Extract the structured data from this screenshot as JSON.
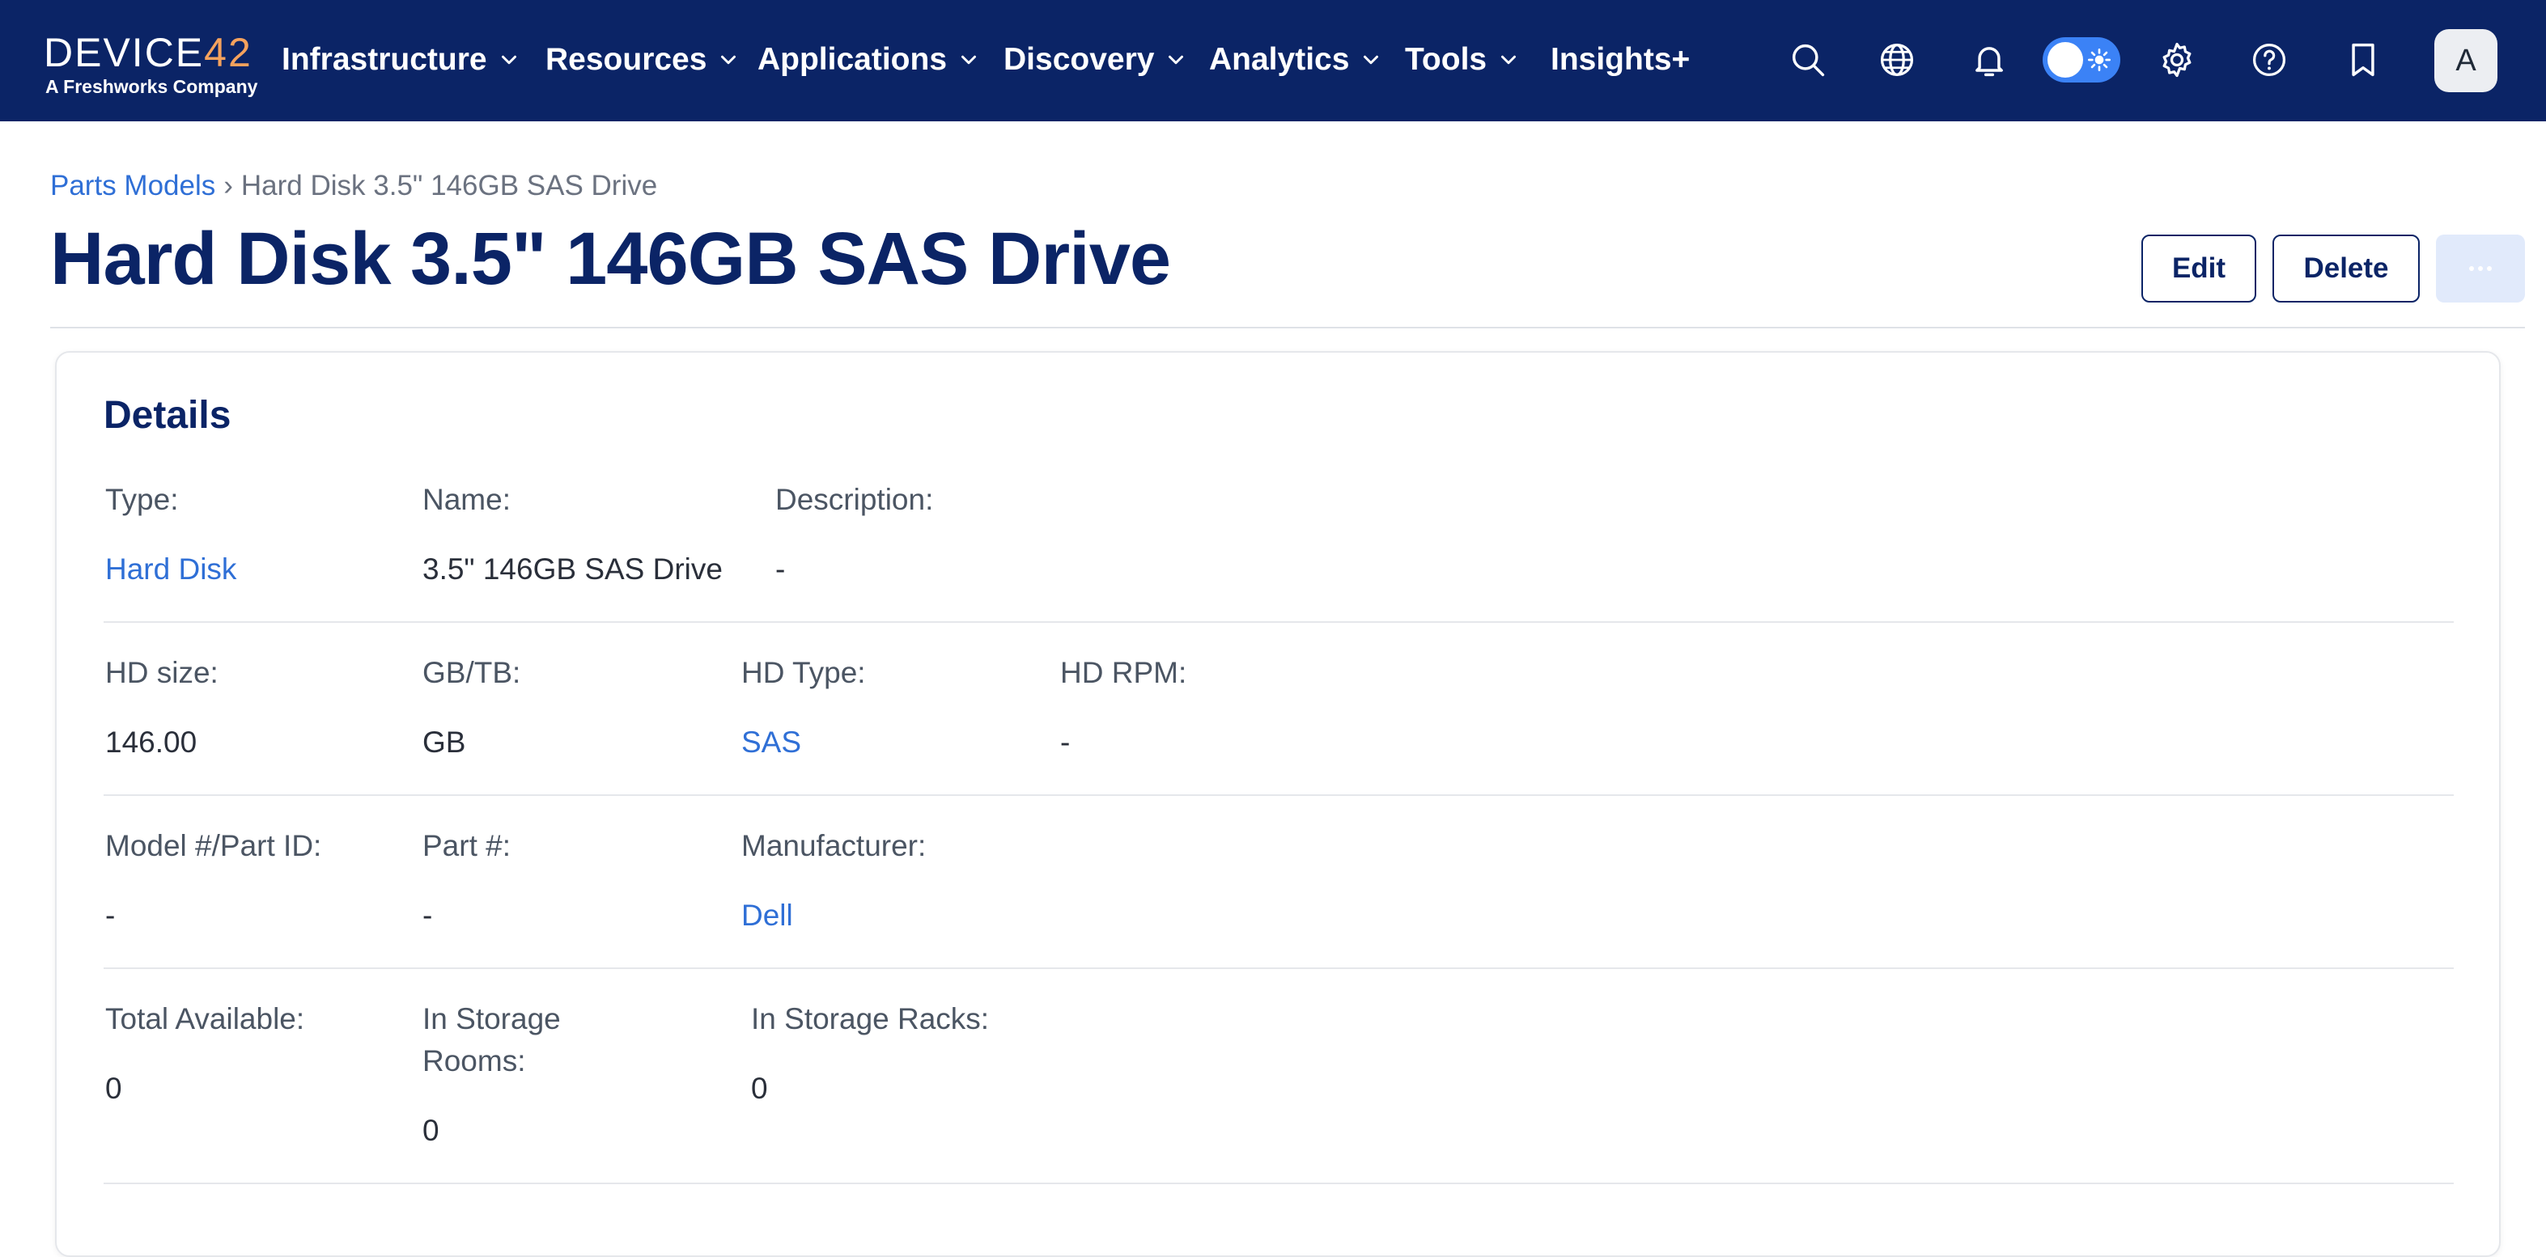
{
  "logo": {
    "word_main": "DEVICE",
    "word_accent": "42",
    "tagline": "A Freshworks Company"
  },
  "nav": {
    "items": [
      {
        "label": "Infrastructure",
        "has_dropdown": true
      },
      {
        "label": "Resources",
        "has_dropdown": true
      },
      {
        "label": "Applications",
        "has_dropdown": true
      },
      {
        "label": "Discovery",
        "has_dropdown": true
      },
      {
        "label": "Analytics",
        "has_dropdown": true
      },
      {
        "label": "Tools",
        "has_dropdown": true
      },
      {
        "label": "Insights+",
        "has_dropdown": false
      }
    ],
    "icons": [
      "search-icon",
      "globe-icon",
      "bell-icon",
      "theme-toggle",
      "gear-icon",
      "help-icon",
      "bookmark-icon"
    ],
    "avatar_initial": "A"
  },
  "breadcrumb": {
    "parent": "Parts Models",
    "separator": "›",
    "current": "Hard Disk 3.5\" 146GB SAS Drive"
  },
  "page": {
    "title": "Hard Disk 3.5\" 146GB SAS Drive"
  },
  "actions": {
    "edit_label": "Edit",
    "delete_label": "Delete",
    "more_icon": "more-dots-icon"
  },
  "details": {
    "title": "Details",
    "type_label": "Type:",
    "type_value": "Hard Disk",
    "name_label": "Name:",
    "name_value": "3.5\" 146GB SAS Drive",
    "description_label": "Description:",
    "description_value": "-",
    "hd_size_label": "HD size:",
    "hd_size_value": "146.00",
    "gbtb_label": "GB/TB:",
    "gbtb_value": "GB",
    "hd_type_label": "HD Type:",
    "hd_type_value": "SAS",
    "hd_rpm_label": "HD RPM:",
    "hd_rpm_value": "-",
    "model_label": "Model #/Part ID:",
    "model_value": "-",
    "part_label": "Part #:",
    "part_value": "-",
    "manufacturer_label": "Manufacturer:",
    "manufacturer_value": "Dell",
    "total_available_label": "Total Available:",
    "total_available_value": "0",
    "in_storage_rooms_label": "In Storage Rooms:",
    "in_storage_rooms_value": "0",
    "in_storage_racks_label": "In Storage Racks:",
    "in_storage_racks_value": "0"
  },
  "colors": {
    "nav_bg": "#0b2466",
    "brand_accent": "#f5a25d",
    "link": "#2f6fd6",
    "title": "#0b2466",
    "toggle_on": "#3b82f6"
  }
}
